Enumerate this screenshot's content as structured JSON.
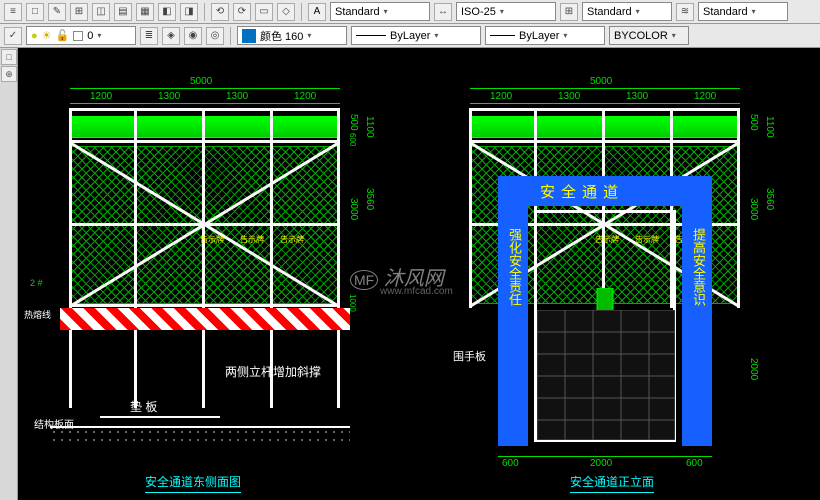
{
  "toolbar1": {
    "text_style": "Standard",
    "dim_style": "ISO-25",
    "style3": "Standard",
    "style4": "Standard"
  },
  "toolbar2": {
    "layer_label": "0",
    "color_label": "颜色 160",
    "linetype": "ByLayer",
    "lineweight": "ByLayer",
    "plotstyle": "BYCOLOR"
  },
  "dims": {
    "d5000": "5000",
    "d1200": "1200",
    "d1300": "1300",
    "d500": "500",
    "d600": "600",
    "d1100": "1100",
    "d3000": "3000",
    "d3560": "3560",
    "d1000": "1000",
    "d2000": "2000",
    "d2": "2 #"
  },
  "notes": {
    "both_sides": "两侧立杆增加斜撑",
    "pad": "垫  板",
    "structure": "结构板面",
    "handrail": "围手板",
    "sign_small": "告示牌"
  },
  "sign": {
    "top": "安全通道",
    "left": "强化安全责任",
    "right": "提高安全意识"
  },
  "titles": {
    "left": "安全通道东侧面图",
    "right": "安全通道正立面"
  },
  "watermark": {
    "main": "沐风网",
    "sub": "www.mfcad.com"
  },
  "chart_data": {
    "type": "diagram",
    "description": "CAD drawing of safety passage structure - east side elevation and front elevation",
    "drawings": [
      {
        "name": "east_side_elevation",
        "title": "安全通道东侧面图",
        "overall_width": 5000,
        "bay_widths": [
          1200,
          1300,
          1300,
          1200
        ],
        "heights": {
          "top_band": 500,
          "top_total": 1100,
          "mesh_zone": 3000,
          "total_upper": 3560,
          "hazard_band": 1000
        },
        "elements": [
          "green_top_band",
          "crosshatch_mesh",
          "diagonal_bracing",
          "hazard_stripe_base",
          "pad_plate",
          "structural_slab"
        ]
      },
      {
        "name": "front_elevation",
        "title": "安全通道正立面",
        "overall_width": 5000,
        "bay_widths": [
          1200,
          1300,
          1300,
          1200
        ],
        "gate": {
          "side_post": 600,
          "opening": 2000,
          "height_lower": 2000
        },
        "heights": {
          "top_band": 500,
          "top_total": 1100,
          "mesh_zone": 3000,
          "total_upper": 3560
        },
        "sign": {
          "top_text": "安全通道",
          "left_text": "强化安全责任",
          "right_text": "提高安全意识"
        },
        "arrow": "downward_entry_arrow",
        "floor": "grid_paving"
      }
    ]
  }
}
